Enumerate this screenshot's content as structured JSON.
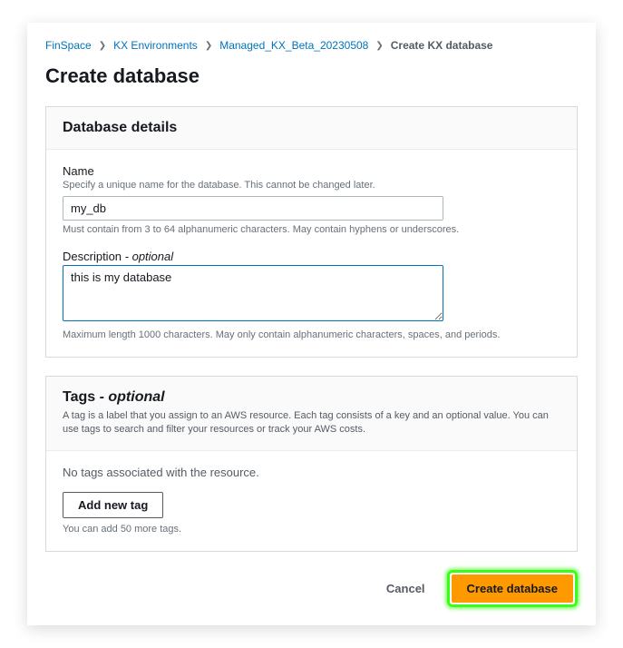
{
  "breadcrumb": {
    "items": [
      {
        "label": "FinSpace"
      },
      {
        "label": "KX Environments"
      },
      {
        "label": "Managed_KX_Beta_20230508"
      }
    ],
    "current": "Create KX database"
  },
  "page": {
    "title": "Create database"
  },
  "details": {
    "heading": "Database details",
    "name": {
      "label": "Name",
      "hint": "Specify a unique name for the database. This cannot be changed later.",
      "value": "my_db",
      "constraint": "Must contain from 3 to 64 alphanumeric characters. May contain hyphens or underscores."
    },
    "description": {
      "label": "Description",
      "optional_suffix": "- optional",
      "value": "this is my database",
      "constraint": "Maximum length 1000 characters. May only contain alphanumeric characters, spaces, and periods."
    }
  },
  "tags": {
    "heading": "Tags",
    "optional_suffix": "- optional",
    "description": "A tag is a label that you assign to an AWS resource. Each tag consists of a key and an optional value. You can use tags to search and filter your resources or track your AWS costs.",
    "empty_text": "No tags associated with the resource.",
    "add_button": "Add new tag",
    "limit_text": "You can add 50 more tags."
  },
  "actions": {
    "cancel": "Cancel",
    "submit": "Create database"
  }
}
